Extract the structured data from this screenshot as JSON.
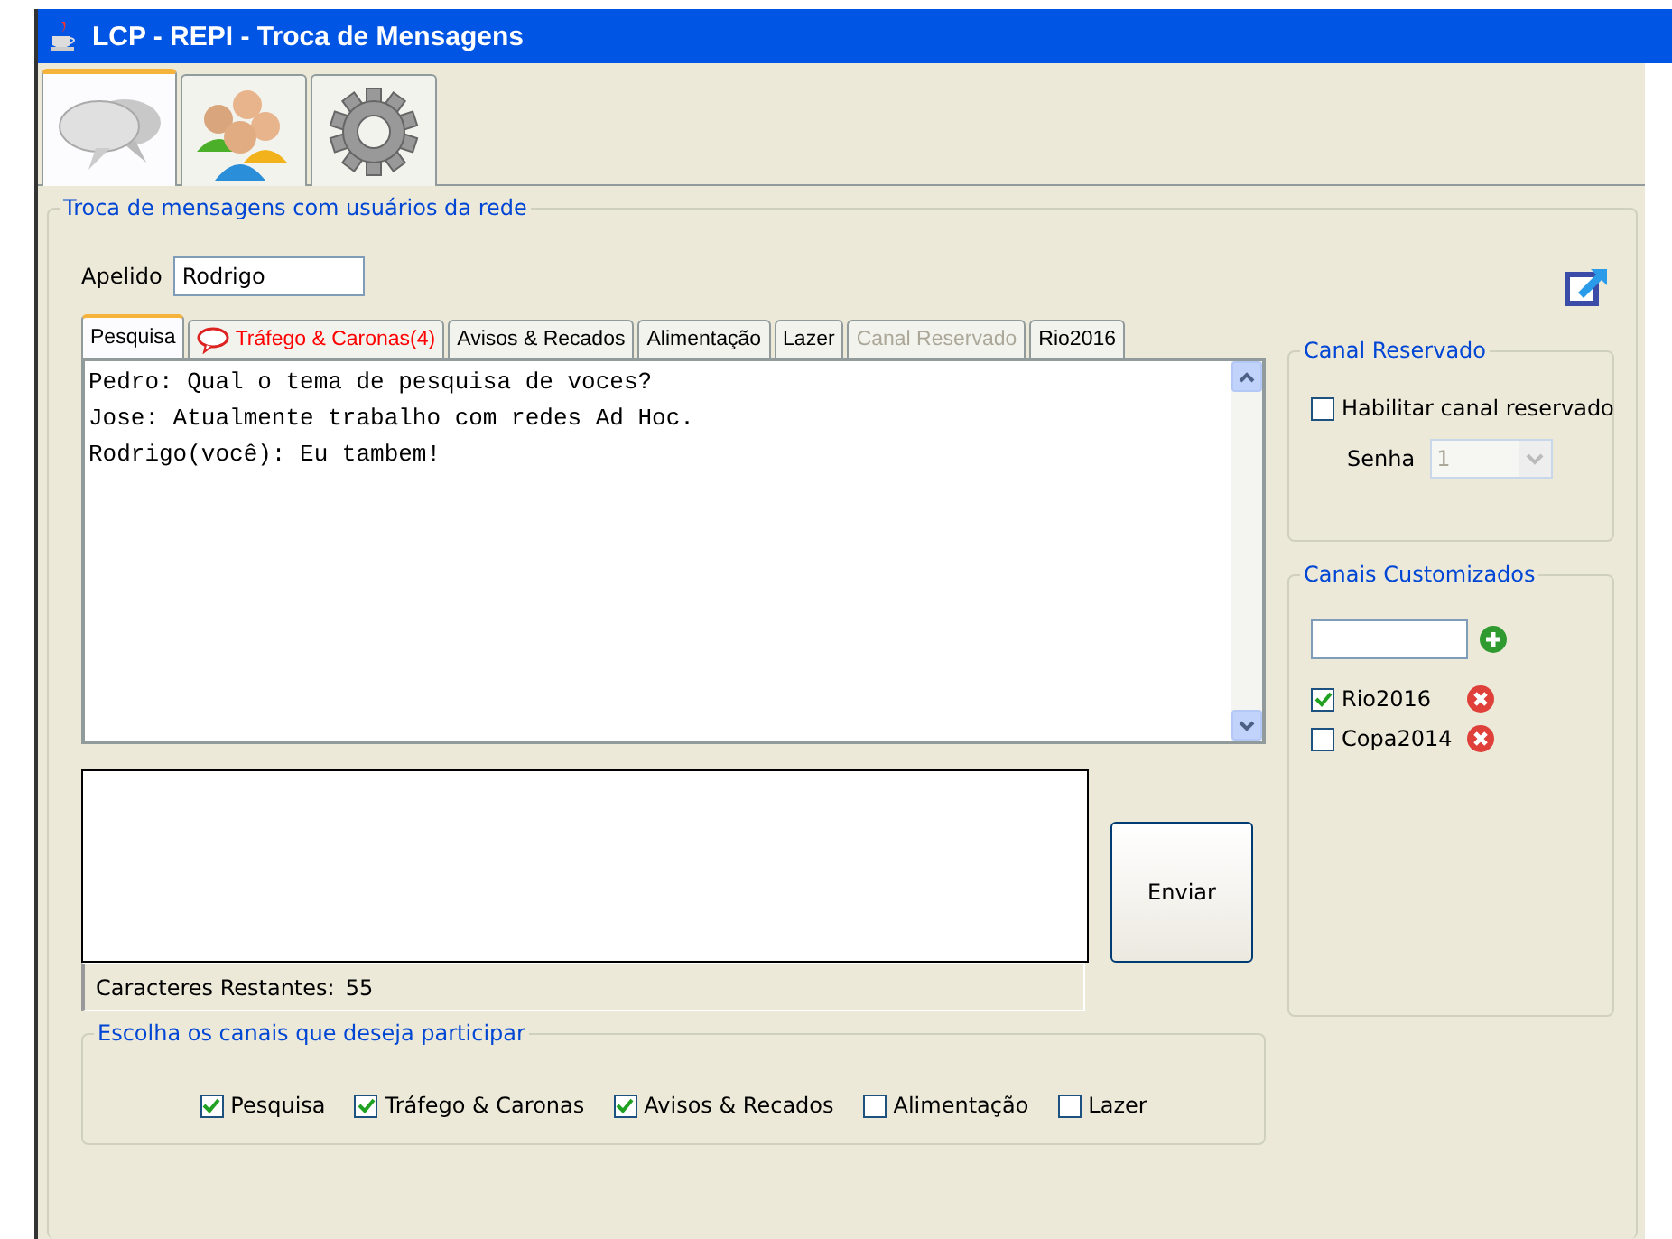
{
  "window": {
    "title": "LCP - REPI - Troca de Mensagens"
  },
  "main_tabs": [
    {
      "kind": "chat",
      "selected": true
    },
    {
      "kind": "users",
      "selected": false
    },
    {
      "kind": "settings",
      "selected": false
    }
  ],
  "group_title": "Troca de mensagens com usuários da rede",
  "nickname": {
    "label": "Apelido",
    "value": "Rodrigo"
  },
  "channel_tabs": [
    {
      "label": "Pesquisa",
      "selected": true,
      "disabled": false,
      "unread": false
    },
    {
      "label": "Tráfego & Caronas(4)",
      "selected": false,
      "disabled": false,
      "unread": true
    },
    {
      "label": "Avisos & Recados",
      "selected": false,
      "disabled": false,
      "unread": false
    },
    {
      "label": "Alimentação",
      "selected": false,
      "disabled": false,
      "unread": false
    },
    {
      "label": "Lazer",
      "selected": false,
      "disabled": false,
      "unread": false
    },
    {
      "label": "Canal Reservado",
      "selected": false,
      "disabled": true,
      "unread": false
    },
    {
      "label": "Rio2016",
      "selected": false,
      "disabled": false,
      "unread": false
    }
  ],
  "messages": [
    "Pedro: Qual o tema de pesquisa de voces?",
    "Jose: Atualmente trabalho com redes Ad Hoc.",
    "Rodrigo(você): Eu tambem!"
  ],
  "send_button": "Enviar",
  "remaining": {
    "label": "Caracteres Restantes:",
    "value": "55"
  },
  "channels_group": {
    "title": "Escolha os canais que deseja participar",
    "items": [
      {
        "label": "Pesquisa",
        "checked": true
      },
      {
        "label": "Tráfego & Caronas",
        "checked": true
      },
      {
        "label": "Avisos & Recados",
        "checked": true
      },
      {
        "label": "Alimentação",
        "checked": false
      },
      {
        "label": "Lazer",
        "checked": false
      }
    ]
  },
  "reserved": {
    "title": "Canal Reservado",
    "enable_label": "Habilitar canal reservado",
    "enabled": false,
    "password_label": "Senha",
    "password_value": "1"
  },
  "custom": {
    "title": "Canais Customizados",
    "items": [
      {
        "label": "Rio2016",
        "checked": true
      },
      {
        "label": "Copa2014",
        "checked": false
      }
    ]
  }
}
